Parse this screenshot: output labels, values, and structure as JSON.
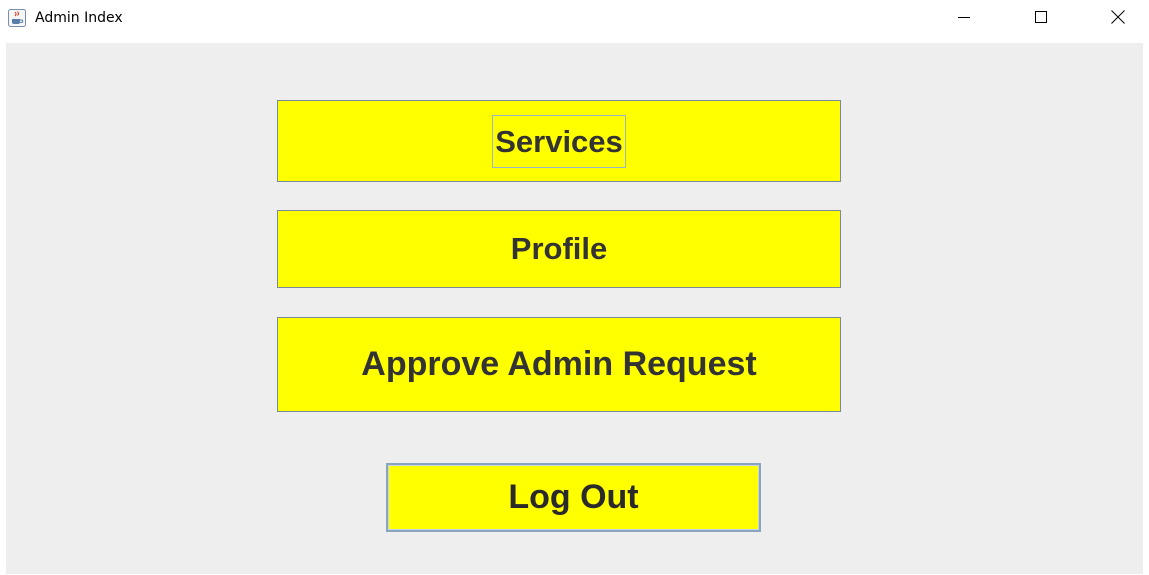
{
  "window": {
    "title": "Admin Index",
    "app_icon": "java-cup-icon",
    "controls": {
      "minimize_icon": "minimize-icon",
      "maximize_icon": "maximize-icon",
      "close_icon": "close-icon"
    }
  },
  "buttons": {
    "services": "Services",
    "profile": "Profile",
    "approve_admin_request": "Approve Admin Request",
    "log_out": "Log Out"
  },
  "colors": {
    "button_background": "#ffff00",
    "panel_background": "#eeeeee",
    "button_text": "#333333"
  }
}
